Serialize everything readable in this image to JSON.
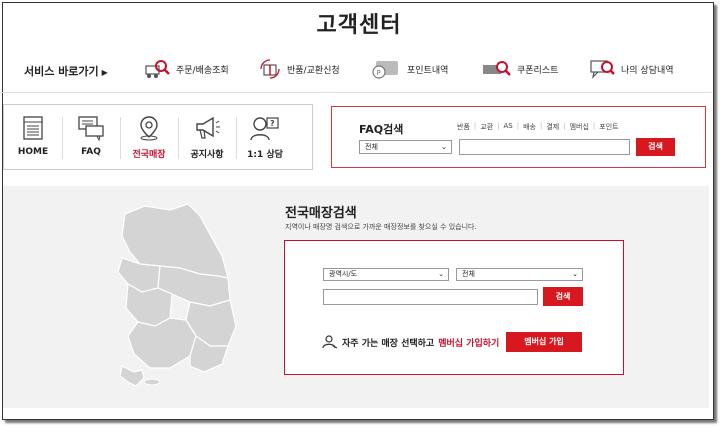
{
  "page_title": "고객센터",
  "service_label": "서비스 바로가기",
  "service_items": [
    {
      "label": "주문/배송조회",
      "icon": "truck-search-icon"
    },
    {
      "label": "반품/교환신청",
      "icon": "gift-return-icon"
    },
    {
      "label": "포인트내역",
      "icon": "point-card-icon"
    },
    {
      "label": "쿠폰리스트",
      "icon": "coupon-search-icon"
    },
    {
      "label": "나의 상담내역",
      "icon": "chat-search-icon"
    }
  ],
  "nav": [
    {
      "label": "HOME",
      "icon": "document-icon",
      "active": false
    },
    {
      "label": "FAQ",
      "icon": "chat-bubbles-icon",
      "active": false
    },
    {
      "label": "전국매장",
      "icon": "location-pin-icon",
      "active": true
    },
    {
      "label": "공지사항",
      "icon": "megaphone-icon",
      "active": false
    },
    {
      "label": "1:1 상담",
      "icon": "person-question-icon",
      "active": false
    }
  ],
  "faq": {
    "title": "FAQ검색",
    "links": [
      "반품",
      "교환",
      "AS",
      "배송",
      "결제",
      "멤버십",
      "포인트"
    ],
    "select_value": "전체",
    "search_button": "검색"
  },
  "store": {
    "title": "전국매장검색",
    "description": "지역이나 매장명 검색으로 가까운 매장정보를 찾으실 수 있습니다.",
    "region_select": "광역시/도",
    "sub_select": "전체",
    "search_button": "검색",
    "member_text": "자주 가는 매장 선택하고",
    "member_highlight": "멤버십 가입하기",
    "member_button": "멤버십 가입"
  },
  "colors": {
    "accent": "#d7191f",
    "map_fill": "#d4d4d4"
  }
}
